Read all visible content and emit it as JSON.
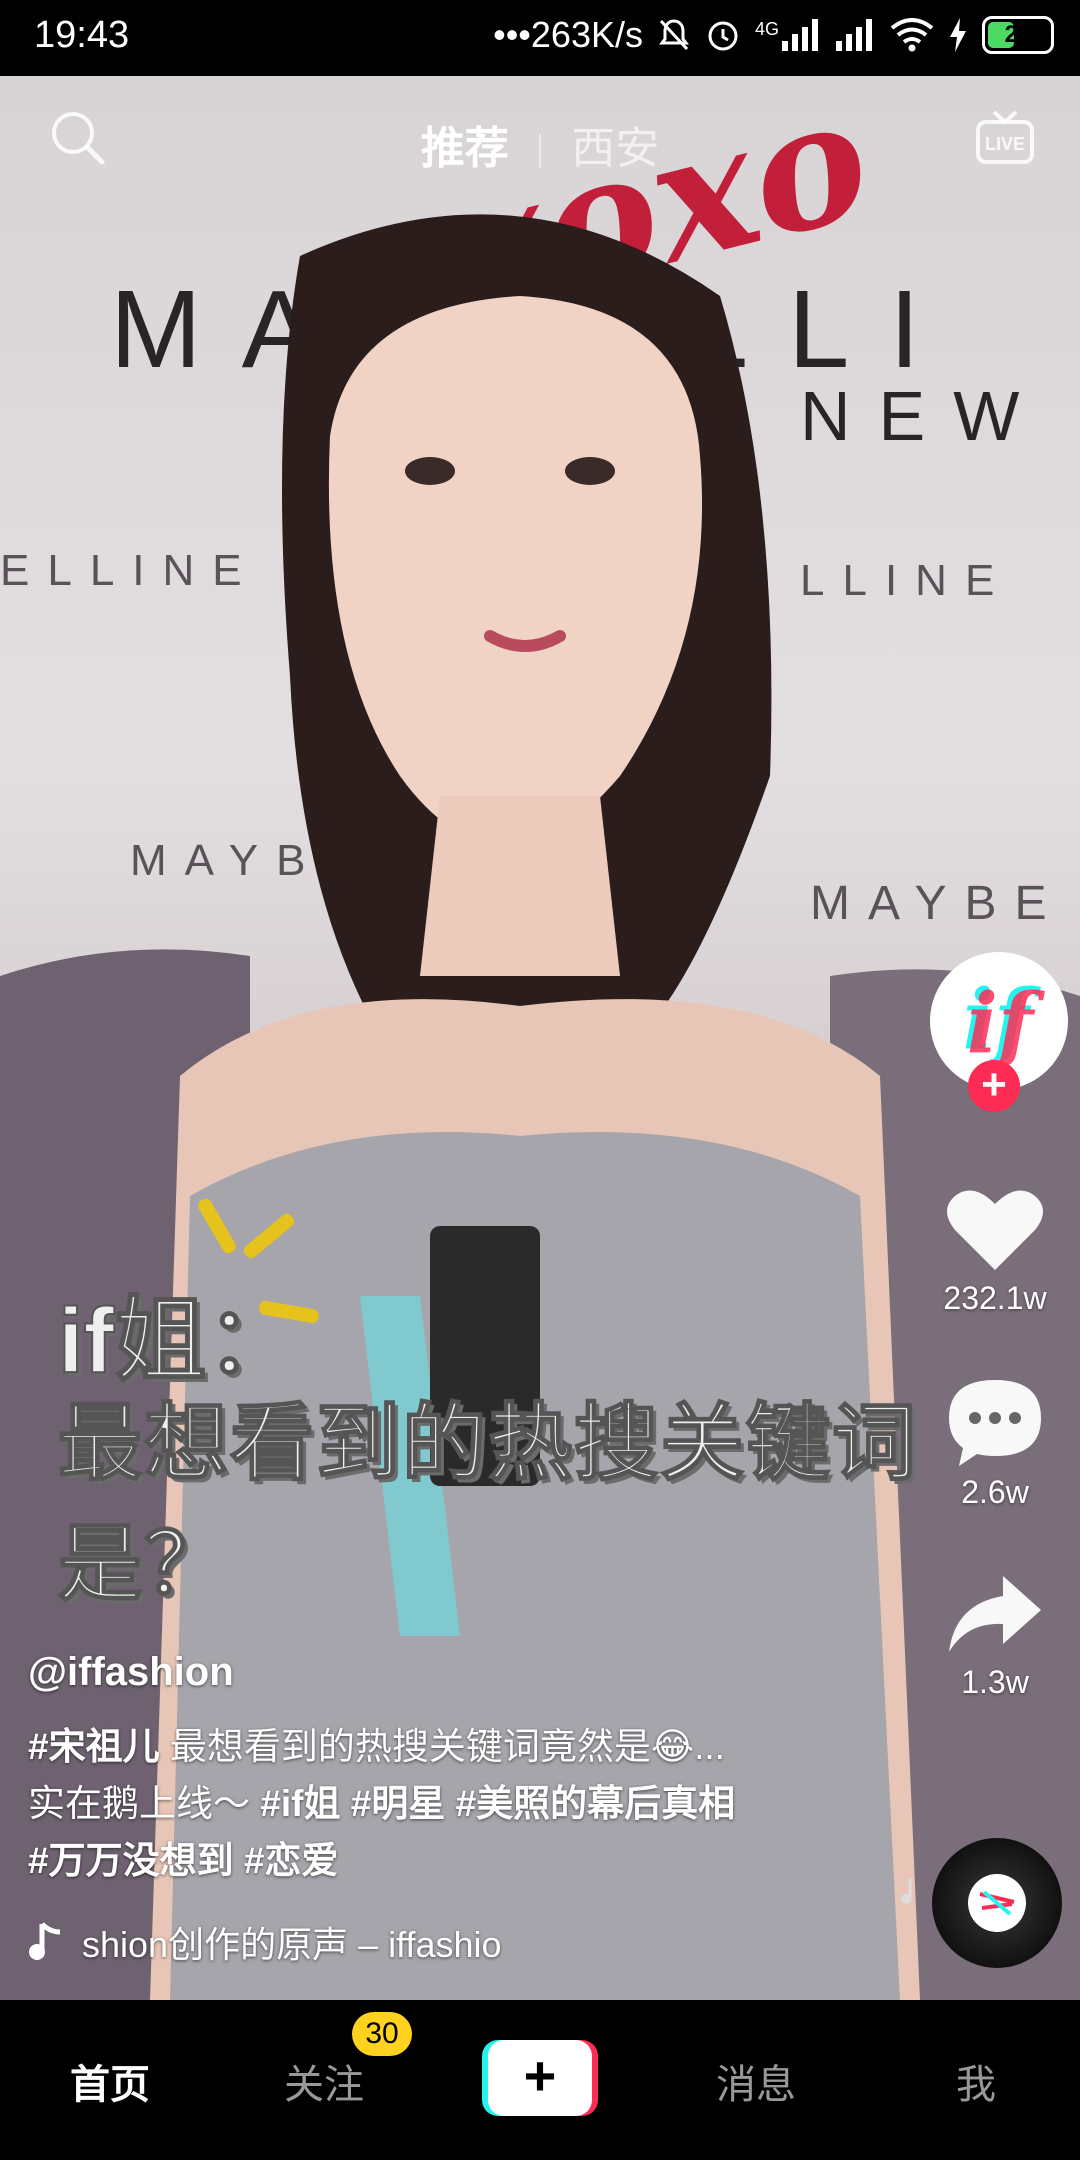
{
  "status_bar": {
    "time": "19:43",
    "network_speed": "•••263K/s",
    "signal_label": "4G",
    "battery_level": "28"
  },
  "video": {
    "backdrop_texts": [
      "MAYBELLI",
      "NEW",
      "ELLINE",
      "LLINE",
      "MAYBE",
      "MAYBE",
      "xoxo"
    ]
  },
  "top_nav": {
    "tabs": [
      {
        "label": "推荐",
        "active": true
      },
      {
        "label": "西安",
        "active": false
      }
    ]
  },
  "overlay_caption": {
    "line1": "if姐：",
    "line2": "最想看到的热搜关键词是？"
  },
  "actions": {
    "avatar_text": "if",
    "likes": "232.1w",
    "comments": "2.6w",
    "shares": "1.3w"
  },
  "post": {
    "author": "@iffashion",
    "desc_line1_tag": "#宋祖儿",
    "desc_line1_text": " 最想看到的热搜关键词竟然是😂...",
    "desc_line2_text": "实在鹅上线～",
    "desc_line2_tags": " #if姐 #明星 #美照的幕后真相",
    "desc_line3_tags": "#万万没想到 #恋爱",
    "music": "shion创作的原声 – iffashio"
  },
  "bottom_nav": {
    "home": "首页",
    "follow": "关注",
    "follow_badge": "30",
    "create": "+",
    "messages": "消息",
    "me": "我"
  },
  "colors": {
    "accent_red": "#fe2c55",
    "accent_cyan": "#25f4ee",
    "badge_yellow": "#ffd21f"
  }
}
